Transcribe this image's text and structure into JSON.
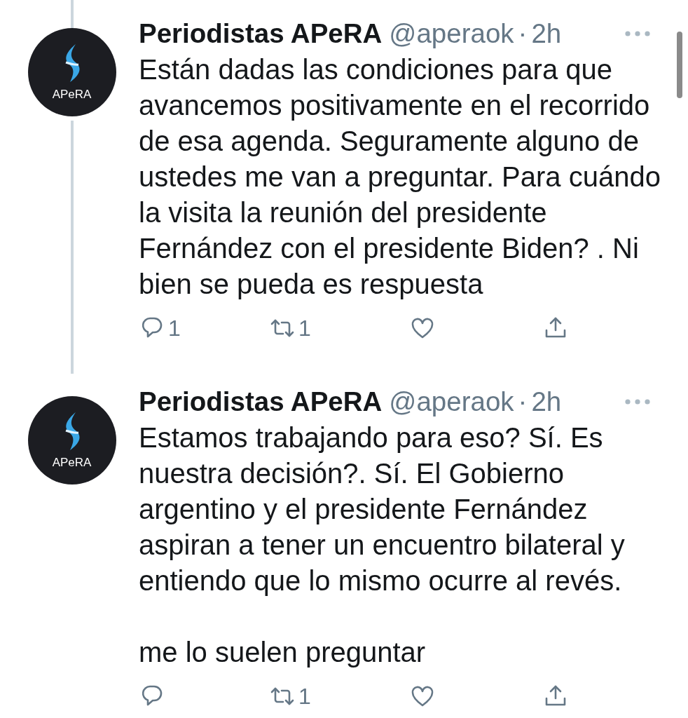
{
  "tweets": [
    {
      "author": "Periodistas APeRA",
      "handle": "@aperaok",
      "separator": "·",
      "time": "2h",
      "avatar_text": "APeRA",
      "thread_above": true,
      "thread_below": true,
      "text": "Están dadas las condiciones para que avancemos positivamente en el recorrido de esa agenda. Seguramente alguno de ustedes me van a preguntar. Para cuándo la visita la reunión del presidente Fernández con el presidente Biden? . Ni bien se pueda es respuesta",
      "actions": [
        {
          "kind": "reply",
          "count": "1"
        },
        {
          "kind": "retweet",
          "count": "1"
        },
        {
          "kind": "like"
        },
        {
          "kind": "share"
        }
      ]
    },
    {
      "author": "Periodistas APeRA",
      "handle": "@aperaok",
      "separator": "·",
      "time": "2h",
      "avatar_text": "APeRA",
      "thread_above": false,
      "thread_below": false,
      "text": "Estamos trabajando para eso? Sí. Es nuestra decisión?. Sí. El Gobierno argentino y el presidente Fernández aspiran a tener un encuentro bilateral y entiendo que lo mismo ocurre al revés.\n\nme lo suelen preguntar",
      "actions": [
        {
          "kind": "reply"
        },
        {
          "kind": "retweet",
          "count": "1"
        },
        {
          "kind": "like"
        },
        {
          "kind": "share"
        }
      ]
    }
  ]
}
